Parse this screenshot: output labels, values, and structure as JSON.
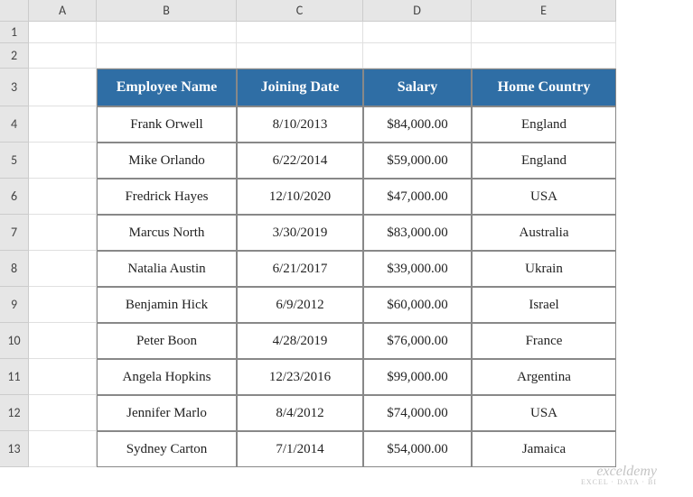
{
  "columns": {
    "labels": [
      "A",
      "B",
      "C",
      "D",
      "E"
    ],
    "widths": [
      75,
      155,
      140,
      120,
      160
    ]
  },
  "rows": {
    "labels": [
      "1",
      "2",
      "3",
      "4",
      "5",
      "6",
      "7",
      "8",
      "9",
      "10",
      "11",
      "12",
      "13"
    ],
    "heights": [
      24,
      28,
      42,
      40,
      40,
      40,
      40,
      40,
      40,
      40,
      40,
      40,
      40
    ]
  },
  "table": {
    "headers": [
      "Employee Name",
      "Joining Date",
      "Salary",
      "Home Country"
    ],
    "rows": [
      {
        "name": "Frank Orwell",
        "date": "8/10/2013",
        "salary": "$84,000.00",
        "country": "England"
      },
      {
        "name": "Mike Orlando",
        "date": "6/22/2014",
        "salary": "$59,000.00",
        "country": "England"
      },
      {
        "name": "Fredrick Hayes",
        "date": "12/10/2020",
        "salary": "$47,000.00",
        "country": "USA"
      },
      {
        "name": "Marcus North",
        "date": "3/30/2019",
        "salary": "$83,000.00",
        "country": "Australia"
      },
      {
        "name": "Natalia Austin",
        "date": "6/21/2017",
        "salary": "$39,000.00",
        "country": "Ukrain"
      },
      {
        "name": "Benjamin Hick",
        "date": "6/9/2012",
        "salary": "$60,000.00",
        "country": "Israel"
      },
      {
        "name": "Peter Boon",
        "date": "4/28/2019",
        "salary": "$76,000.00",
        "country": "France"
      },
      {
        "name": "Angela Hopkins",
        "date": "12/23/2016",
        "salary": "$99,000.00",
        "country": "Argentina"
      },
      {
        "name": "Jennifer Marlo",
        "date": "8/4/2012",
        "salary": "$74,000.00",
        "country": "USA"
      },
      {
        "name": "Sydney Carton",
        "date": "7/1/2014",
        "salary": "$54,000.00",
        "country": "Jamaica"
      }
    ]
  },
  "watermark": {
    "brand": "exceldemy",
    "sub": "EXCEL · DATA · BI"
  }
}
